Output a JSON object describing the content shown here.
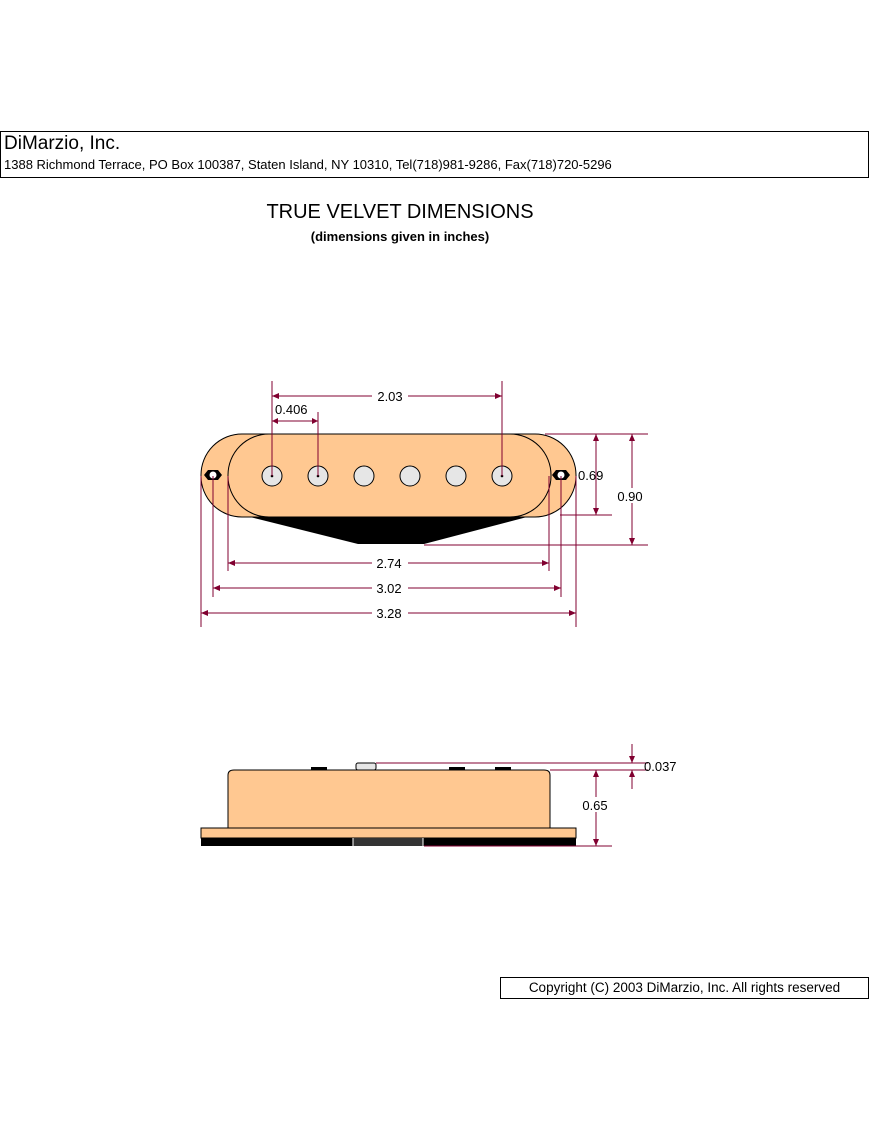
{
  "header": {
    "company": "DiMarzio, Inc.",
    "address": "1388 Richmond Terrace, PO Box 100387, Staten Island, NY 10310, Tel(718)981-9286, Fax(718)720-5296"
  },
  "drawing": {
    "title": "TRUE VELVET DIMENSIONS",
    "subtitle": "(dimensions given in inches)"
  },
  "dimensions": {
    "pole_span": "2.03",
    "pole_spacing": "0.406",
    "inner_height": "0.69",
    "outer_height": "0.90",
    "cover_length": "2.74",
    "mount_hole_spacing": "3.02",
    "overall_length": "3.28",
    "pole_projection": "0.037",
    "cover_height": "0.65"
  },
  "colors": {
    "cover": "#ffc891",
    "dimension_line": "#800030",
    "pole": "#e6e6e6",
    "base": "#000000"
  },
  "footer": {
    "copyright": "Copyright (C) 2003 DiMarzio, Inc. All rights reserved"
  }
}
